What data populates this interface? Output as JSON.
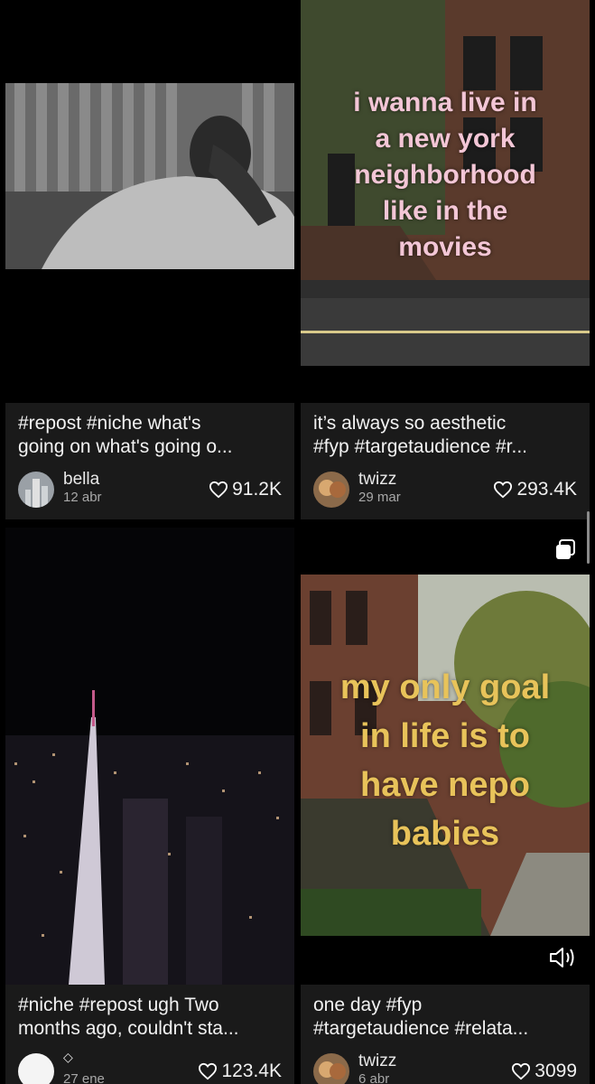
{
  "cards": [
    {
      "caption_line1": "#repost #niche what's",
      "caption_line2": "going on what's going o...",
      "author": "bella",
      "date": "12 abr",
      "likes": "91.2K",
      "thumbnail": "crying-man-interview"
    },
    {
      "caption_line1": "it’s always so aesthetic",
      "caption_line2": "#fyp #targetaudience #r...",
      "author": "twizz",
      "date": "29 mar",
      "likes": "293.4K",
      "overlay_lines": [
        "i wanna live in",
        "a new york",
        "neighborhood",
        "like in the",
        "movies"
      ],
      "thumbnail": "nyc-brownstone-street"
    },
    {
      "caption_line1": "#niche #repost ugh Two",
      "caption_line2": "months ago, couldn't sta...",
      "author": "◇",
      "date": "27 ene",
      "likes": "123.4K",
      "thumbnail": "nyc-night-skyline"
    },
    {
      "caption_line1": "one day #fyp",
      "caption_line2": "#targetaudience #relata...",
      "author": "twizz",
      "date": "6 abr",
      "likes": "3099",
      "overlay_lines": [
        "my only goal",
        "in life is to",
        "have nepo",
        "babies"
      ],
      "thumbnail": "brownstone-sidewalk-trees",
      "badge_icon": "multi-photo-icon",
      "sound_icon": "speaker-icon"
    }
  ],
  "colors": {
    "background": "#000000",
    "card_meta": "#1a1a1a",
    "overlay_pink": "#f3c6d6",
    "overlay_gold": "#e8c35a"
  }
}
